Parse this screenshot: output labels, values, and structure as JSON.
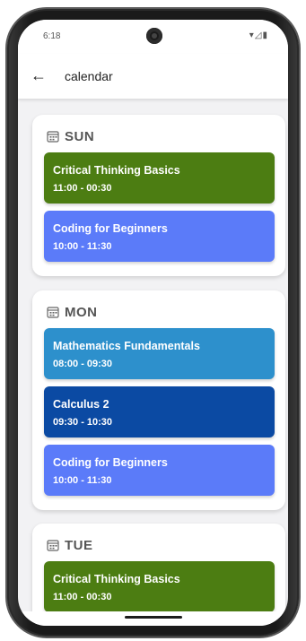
{
  "status_bar": {
    "time": "6:18",
    "icons": "▾◿▮"
  },
  "app_bar": {
    "back_icon": "←",
    "title": "calendar"
  },
  "days": [
    {
      "name": "SUN",
      "events": [
        {
          "title": "Critical Thinking Basics",
          "time": "11:00 - 00:30",
          "color": "#4c7d12"
        },
        {
          "title": "Coding for Beginners",
          "time": "10:00 - 11:30",
          "color": "#5b7bf9"
        }
      ]
    },
    {
      "name": "MON",
      "events": [
        {
          "title": "Mathematics Fundamentals",
          "time": "08:00 - 09:30",
          "color": "#2d90cc"
        },
        {
          "title": "Calculus 2",
          "time": "09:30 - 10:30",
          "color": "#0b4aa3"
        },
        {
          "title": "Coding for Beginners",
          "time": "10:00 - 11:30",
          "color": "#5b7bf9"
        }
      ]
    },
    {
      "name": "TUE",
      "events": [
        {
          "title": "Critical Thinking Basics",
          "time": "11:00 - 00:30",
          "color": "#4c7d12"
        }
      ]
    }
  ]
}
